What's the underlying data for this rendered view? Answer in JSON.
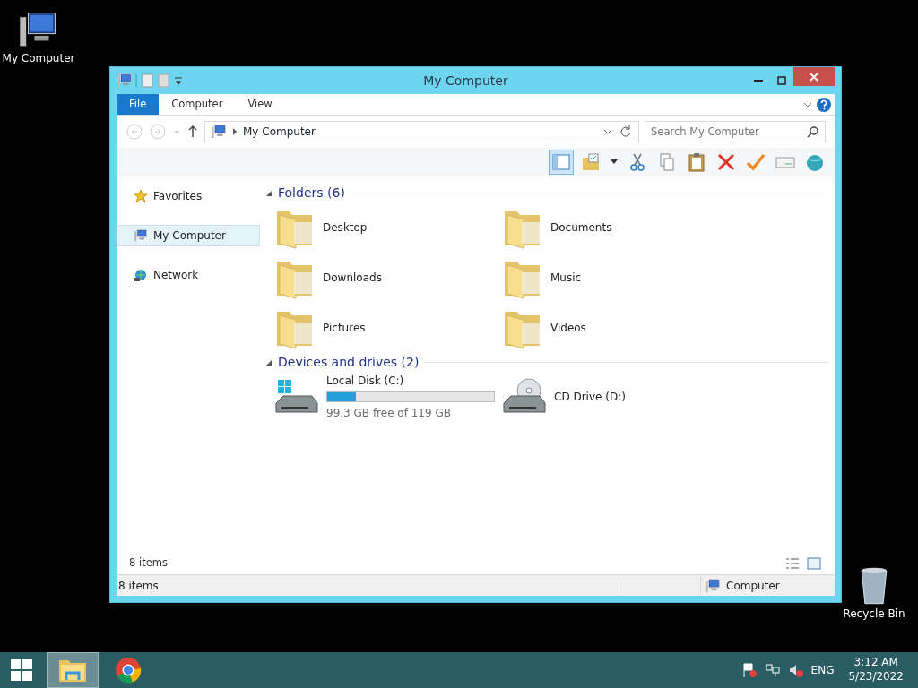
{
  "desktop_icons": [
    {
      "label": "My Computer",
      "kind": "computer"
    },
    {
      "label": "Recycle Bin",
      "kind": "recycle"
    }
  ],
  "window": {
    "title": "My Computer",
    "ribbon_tabs": [
      {
        "label": "File",
        "selected": true
      },
      {
        "label": "Computer",
        "selected": false
      },
      {
        "label": "View",
        "selected": false
      }
    ],
    "address": "My Computer",
    "search": {
      "placeholder": "Search My Computer"
    },
    "sidebar": [
      {
        "label": "Favorites",
        "kind": "star",
        "selected": false
      },
      {
        "label": "My Computer",
        "kind": "computer",
        "selected": true
      },
      {
        "label": "Network",
        "kind": "network",
        "selected": false
      }
    ],
    "groups": [
      {
        "title": "Folders (6)",
        "items": [
          {
            "label": "Desktop",
            "kind": "folder"
          },
          {
            "label": "Documents",
            "kind": "folder"
          },
          {
            "label": "Downloads",
            "kind": "folder"
          },
          {
            "label": "Music",
            "kind": "folder"
          },
          {
            "label": "Pictures",
            "kind": "folder"
          },
          {
            "label": "Videos",
            "kind": "folder"
          }
        ]
      },
      {
        "title": "Devices and drives (2)",
        "items": [
          {
            "label": "Local Disk (C:)",
            "kind": "disk",
            "level": 0.17,
            "detail": "99.3 GB free of 119 GB"
          },
          {
            "label": "CD Drive (D:)",
            "kind": "cd"
          }
        ]
      }
    ],
    "item_count": "8 items",
    "status": {
      "text": "8 items",
      "location": "Computer"
    }
  },
  "taskbar": {
    "apps": [
      {
        "kind": "explorer",
        "selected": true
      },
      {
        "kind": "browser",
        "selected": false
      }
    ],
    "language": "ENG",
    "time": "3:12 AM",
    "date": "5/23/2022"
  }
}
